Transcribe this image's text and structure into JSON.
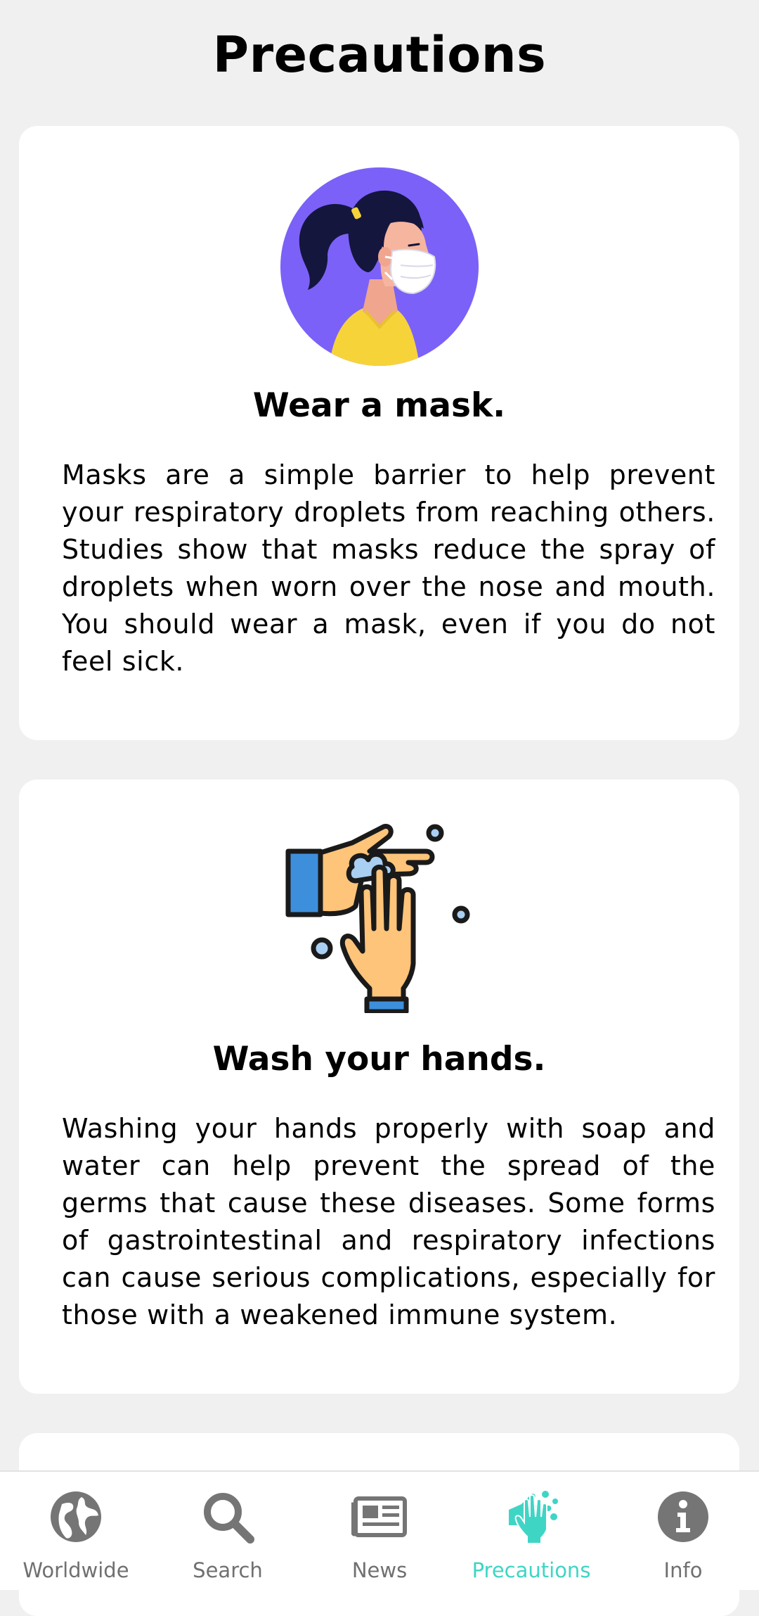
{
  "page": {
    "title": "Precautions"
  },
  "cards": [
    {
      "icon": "woman-wearing-mask-illustration",
      "title": "Wear a mask.",
      "body": "Masks are a simple barrier to help prevent your respiratory droplets from reaching others. Studies show that masks reduce the spray of droplets when worn over the nose and mouth. You should wear a mask, even if you do not feel sick."
    },
    {
      "icon": "washing-hands-illustration",
      "title": "Wash your hands.",
      "body": "Washing your hands properly with soap and water can help prevent the spread of the germs that cause these diseases. Some forms of gastrointestinal and respiratory infections can cause serious complications, especially for those with a weakened immune system."
    }
  ],
  "nav": {
    "active": "Precautions",
    "items": [
      {
        "label": "Worldwide",
        "icon": "globe-icon"
      },
      {
        "label": "Search",
        "icon": "search-icon"
      },
      {
        "label": "News",
        "icon": "newspaper-icon"
      },
      {
        "label": "Precautions",
        "icon": "hand-wash-icon"
      },
      {
        "label": "Info",
        "icon": "info-icon"
      }
    ]
  },
  "colors": {
    "background": "#f0f0f0",
    "card": "#ffffff",
    "accent": "#3fd5c5",
    "nav_inactive": "#707070",
    "mask_circle": "#7b61f8"
  }
}
